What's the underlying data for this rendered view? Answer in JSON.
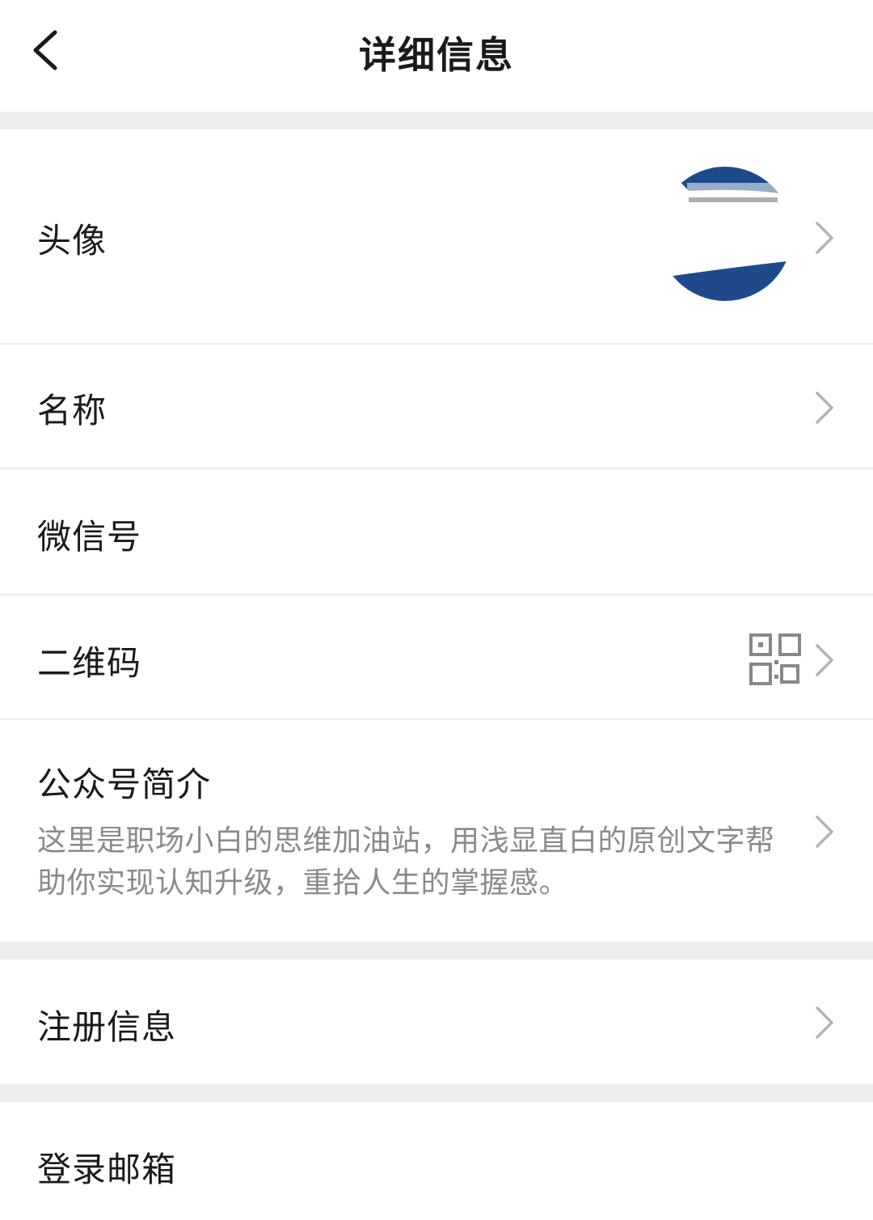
{
  "header": {
    "title": "详细信息",
    "back_icon": "chevron-left-icon"
  },
  "rows": {
    "avatar": {
      "label": "头像",
      "icon": "chevron-right-icon"
    },
    "name": {
      "label": "名称",
      "icon": "chevron-right-icon"
    },
    "wechat_id": {
      "label": "微信号"
    },
    "qrcode": {
      "label": "二维码",
      "qr_icon": "qr-code-icon",
      "icon": "chevron-right-icon"
    },
    "intro": {
      "label": "公众号简介",
      "text": "这里是职场小白的思维加油站，用浅显直白的原创文字帮助你实现认知升级，重拾人生的掌握感。",
      "icon": "chevron-right-icon"
    },
    "registration": {
      "label": "注册信息",
      "icon": "chevron-right-icon"
    },
    "login_email": {
      "label": "登录邮箱"
    }
  },
  "colors": {
    "background": "#ededed",
    "card": "#ffffff",
    "text": "#1a1a1a",
    "secondary_text": "#8a8a8a",
    "chevron": "#b3b3b3",
    "avatar_accent": "#1e4a8c"
  }
}
